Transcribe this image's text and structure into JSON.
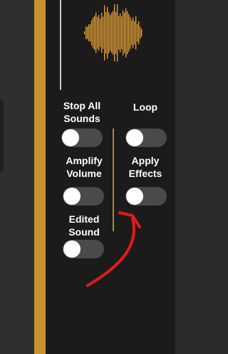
{
  "controls": {
    "stop_all_sounds": {
      "label": "Stop All\nSounds",
      "on": false
    },
    "loop": {
      "label": "Loop",
      "on": false
    },
    "amplify_volume": {
      "label": "Amplify\nVolume",
      "on": false
    },
    "apply_effects": {
      "label": "Apply\nEffects",
      "on": false
    },
    "edited_sound": {
      "label": "Edited\nSound",
      "on": false
    }
  },
  "colors": {
    "accent_orange": "#c8922f",
    "waveform": "#e8a236",
    "annotation_arrow": "#e01b1b",
    "toggle_track": "#4a4a4a"
  },
  "annotation": {
    "icon": "hand-drawn-arrow-icon",
    "points_to": "apply-effects-toggle"
  }
}
